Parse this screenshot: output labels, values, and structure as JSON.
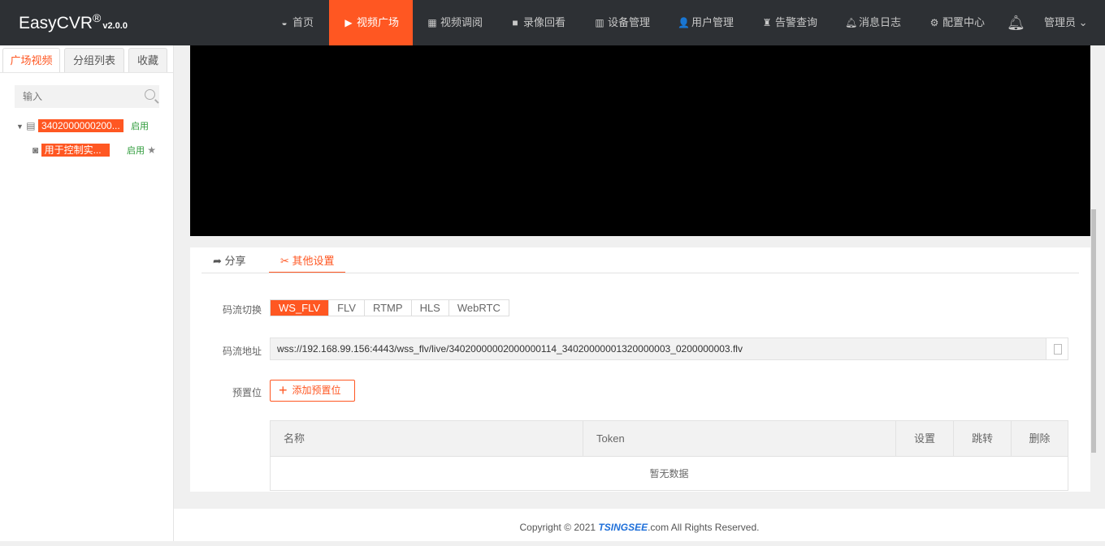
{
  "header": {
    "logo": "EasyCVR",
    "logo_reg": "®",
    "version": "v2.0.0",
    "nav": [
      {
        "label": "首页",
        "icon": "dashboard-icon"
      },
      {
        "label": "视频广场",
        "icon": "play-circle-icon",
        "active": true
      },
      {
        "label": "视频调阅",
        "icon": "layout-icon"
      },
      {
        "label": "录像回看",
        "icon": "video-camera-icon"
      },
      {
        "label": "设备管理",
        "icon": "device-icon"
      },
      {
        "label": "用户管理",
        "icon": "user-icon"
      },
      {
        "label": "告警查询",
        "icon": "alarm-icon"
      },
      {
        "label": "消息日志",
        "icon": "bell-icon"
      },
      {
        "label": "配置中心",
        "icon": "gear-icon"
      }
    ],
    "user": "管理员"
  },
  "sidebar": {
    "tabs": [
      "广场视频",
      "分组列表",
      "收藏"
    ],
    "search_placeholder": "输入",
    "tree": [
      {
        "label": "3402000000200...",
        "status": "启用"
      },
      {
        "label": "用于控制实...",
        "status": "启用"
      }
    ]
  },
  "panel": {
    "tabs": [
      "分享",
      "其他设置"
    ],
    "stream_label": "码流切换",
    "streams": [
      "WS_FLV",
      "FLV",
      "RTMP",
      "HLS",
      "WebRTC"
    ],
    "url_label": "码流地址",
    "url": "wss://192.168.99.156:4443/wss_flv/live/34020000002000000114_34020000001320000003_0200000003.flv",
    "preset_label": "预置位",
    "add_preset": "添加预置位",
    "table": {
      "columns": [
        "名称",
        "Token",
        "设置",
        "跳转",
        "删除"
      ],
      "empty": "暂无数据"
    }
  },
  "footer": {
    "pre": "Copyright © 2021 ",
    "brand": "TSINGSEE",
    "post": ".com All Rights Reserved."
  },
  "colors": {
    "accent": "#ff5722",
    "header": "#2d3034"
  }
}
